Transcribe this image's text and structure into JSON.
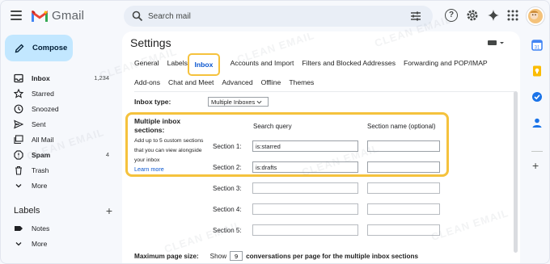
{
  "app": {
    "name": "Gmail"
  },
  "search": {
    "placeholder": "Search mail"
  },
  "compose": {
    "label": "Compose"
  },
  "nav": {
    "items": [
      {
        "label": "Inbox",
        "count": "1,234",
        "bold": true
      },
      {
        "label": "Starred",
        "count": ""
      },
      {
        "label": "Snoozed",
        "count": ""
      },
      {
        "label": "Sent",
        "count": ""
      },
      {
        "label": "All Mail",
        "count": ""
      },
      {
        "label": "Spam",
        "count": "4",
        "bold": true
      },
      {
        "label": "Trash",
        "count": ""
      },
      {
        "label": "More",
        "count": ""
      }
    ],
    "labels_header": "Labels",
    "label_items": [
      {
        "label": "Notes"
      },
      {
        "label": "More"
      }
    ]
  },
  "settings": {
    "title": "Settings",
    "tabs_row1": [
      "General",
      "Labels",
      "Inbox",
      "Accounts and Import",
      "Filters and Blocked Addresses",
      "Forwarding and POP/IMAP"
    ],
    "tabs_row2": [
      "Add-ons",
      "Chat and Meet",
      "Advanced",
      "Offline",
      "Themes"
    ],
    "active_tab": "Inbox",
    "inbox_type": {
      "label": "Inbox type:",
      "value": "Multiple Inboxes"
    },
    "multiple_inbox": {
      "title": "Multiple inbox sections:",
      "description": "Add up to 5 custom sections that you can view alongside your inbox",
      "learn_more": "Learn more",
      "col_query": "Search query",
      "col_name": "Section name (optional)",
      "sections": [
        {
          "label": "Section 1:",
          "query": "is:starred",
          "name": ""
        },
        {
          "label": "Section 2:",
          "query": "is:drafts",
          "name": ""
        },
        {
          "label": "Section 3:",
          "query": "",
          "name": ""
        },
        {
          "label": "Section 4:",
          "query": "",
          "name": ""
        },
        {
          "label": "Section 5:",
          "query": "",
          "name": ""
        }
      ]
    },
    "max_page": {
      "label": "Maximum page size:",
      "show": "Show",
      "value": "9",
      "suffix": "conversations per page for the multiple inbox sections"
    }
  },
  "watermark": "CLEAN EMAIL",
  "colors": {
    "accent": "#0b57d0",
    "highlight": "#f5c23d",
    "compose_bg": "#c2e7ff"
  }
}
